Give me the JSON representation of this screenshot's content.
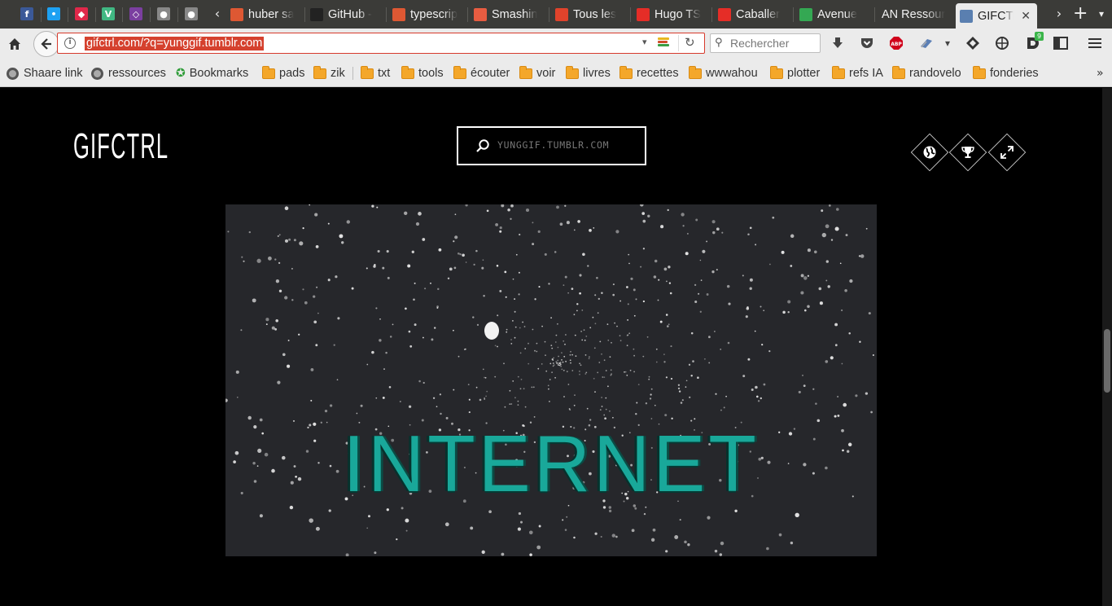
{
  "browser": {
    "pinned_tabs": [
      {
        "icon": "facebook-icon",
        "glyph": "f",
        "color": "#3b5998"
      },
      {
        "icon": "twitter-icon",
        "glyph": "•",
        "color": "#1da1f2"
      },
      {
        "icon": "raindrop-icon",
        "glyph": "◆",
        "color": "#e0284a"
      },
      {
        "icon": "vue-icon",
        "glyph": "V",
        "color": "#41b883"
      },
      {
        "icon": "graph-icon",
        "glyph": "◇",
        "color": "#7b3fa0"
      },
      {
        "icon": "globe-icon",
        "glyph": "●",
        "color": "#888888"
      },
      {
        "icon": "globe-icon",
        "glyph": "●",
        "color": "#888888"
      }
    ],
    "tabs": [
      {
        "label": "huber sa",
        "icon": "duckduckgo-icon",
        "color": "#de5833"
      },
      {
        "label": "GitHub -",
        "icon": "github-icon",
        "color": "#222222"
      },
      {
        "label": "typescrip",
        "icon": "duckduckgo-icon",
        "color": "#de5833"
      },
      {
        "label": "Smashin",
        "icon": "smashing-icon",
        "color": "#e85c41"
      },
      {
        "label": "Tous les",
        "icon": "a-icon",
        "color": "#e0432b"
      },
      {
        "label": "Hugo TS",
        "icon": "youtube-icon",
        "color": "#e52d27"
      },
      {
        "label": "Caballer",
        "icon": "youtube-icon",
        "color": "#e52d27"
      },
      {
        "label": "Avenue",
        "icon": "maps-icon",
        "color": "#34a853"
      },
      {
        "label": "AN Ressour",
        "icon": "",
        "color": ""
      },
      {
        "label": "GIFCTRL",
        "icon": "gifctrl-icon",
        "color": "#5a7fb0",
        "active": true
      }
    ],
    "url": "gifctrl.com/?q=yunggif.tumblr.com",
    "search_placeholder": "Rechercher",
    "addon_badge": "9",
    "bookmarks": [
      {
        "label": "Shaare link",
        "type": "globe"
      },
      {
        "label": "ressources",
        "type": "globe"
      },
      {
        "label": "Bookmarks",
        "type": "star"
      },
      {
        "label": "pads",
        "type": "folder"
      },
      {
        "label": "zik",
        "type": "folder"
      },
      {
        "label": "txt",
        "type": "folder"
      },
      {
        "label": "tools",
        "type": "folder"
      },
      {
        "label": "écouter",
        "type": "folder"
      },
      {
        "label": "voir",
        "type": "folder"
      },
      {
        "label": "livres",
        "type": "folder"
      },
      {
        "label": "recettes",
        "type": "folder"
      },
      {
        "label": "wwwahou",
        "type": "folder"
      },
      {
        "label": "plotter",
        "type": "folder"
      },
      {
        "label": "refs IA",
        "type": "folder"
      },
      {
        "label": "randovelo",
        "type": "folder"
      },
      {
        "label": "fonderies",
        "type": "folder"
      }
    ],
    "overflow_glyph": "»"
  },
  "site": {
    "logo": "GIFCTRL",
    "search_value": "YUNGGIF.TUMBLR.COM",
    "actions": [
      {
        "name": "globe-icon"
      },
      {
        "name": "trophy-icon"
      },
      {
        "name": "fullscreen-icon"
      }
    ],
    "gif_text": "INTERNET"
  },
  "colors": {
    "page_bg": "#000000",
    "gif_bg": "#26272b",
    "gif_text": "#19a89a",
    "url_highlight": "#d5412e"
  }
}
